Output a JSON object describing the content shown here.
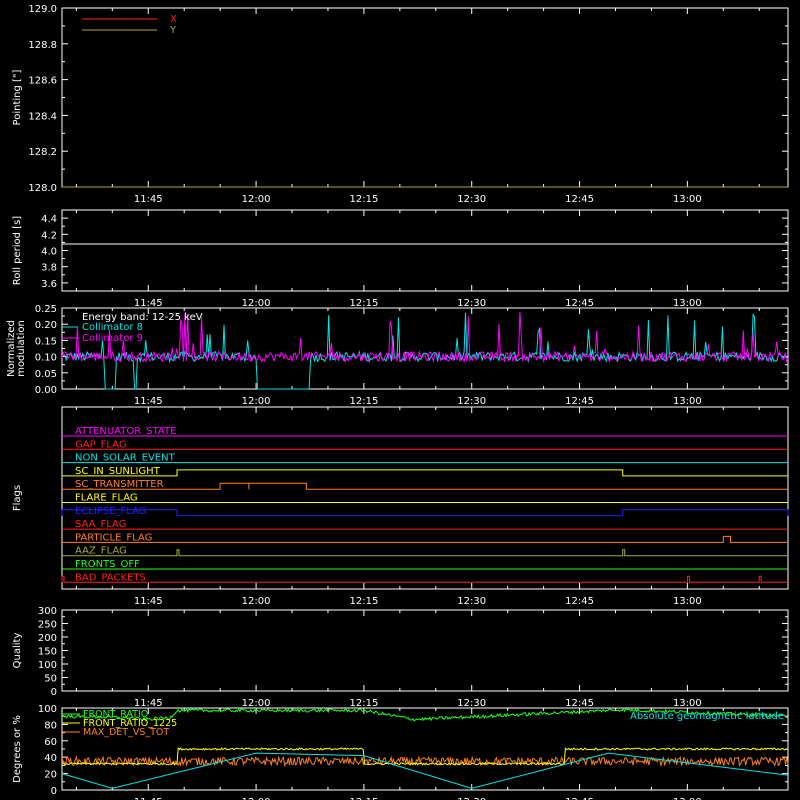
{
  "colors": {
    "background": "#000000",
    "axes": "#ffffff",
    "red": "#ff2020",
    "yellow": "#ffff00",
    "olive": "#a8a838",
    "white": "#ffffff",
    "cyan": "#00e5e5",
    "magenta": "#ff00ff",
    "orange": "#ff8020",
    "blue": "#2020ff",
    "green": "#20ff20"
  },
  "time_axis": {
    "range_minutes": [
      11.55,
      13.23
    ],
    "tick_labels": [
      "11:45",
      "12:00",
      "12:15",
      "12:30",
      "12:45",
      "13:00"
    ]
  },
  "chart_data": [
    {
      "id": "pointing",
      "type": "line",
      "title": "",
      "ylabel": "Pointing [\"]",
      "ylim": [
        128.0,
        129.0
      ],
      "yticks": [
        "128.0",
        "128.2",
        "128.4",
        "128.6",
        "128.8",
        "129.0"
      ],
      "legend": "top-left",
      "series": [
        {
          "name": "X",
          "color": "#ff2020",
          "x": [
            "11:33",
            "13:14"
          ],
          "y": [
            128.0,
            128.0
          ]
        },
        {
          "name": "Y",
          "color": "#a8a838",
          "x": [
            "11:33",
            "13:14"
          ],
          "y": [
            128.0,
            128.0
          ]
        }
      ]
    },
    {
      "id": "roll",
      "type": "line",
      "title": "",
      "ylabel": "Roll period [s]",
      "ylim": [
        3.5,
        4.5
      ],
      "yticks": [
        "3.6",
        "3.8",
        "4.0",
        "4.2",
        "4.4"
      ],
      "series": [
        {
          "color": "#ffffff",
          "x": [
            "11:33",
            "13:14"
          ],
          "y": [
            4.08,
            4.08
          ]
        }
      ]
    },
    {
      "id": "modulation",
      "type": "line",
      "title": "",
      "ylabel": "Normalized modulation",
      "ylim": [
        0,
        0.25
      ],
      "yticks": [
        "0.00",
        "0.05",
        "0.10",
        "0.15",
        "0.20",
        "0.25"
      ],
      "annotation": "Energy band: 12-25 keV",
      "legend": "top-left",
      "series": [
        {
          "name": "Collimator 8",
          "color": "#00e5e5",
          "base": 0.1,
          "dropouts": [
            [
              "11:39",
              "11:40"
            ],
            [
              "11:43",
              "11:43"
            ],
            [
              "12:00",
              "12:07"
            ]
          ]
        },
        {
          "name": "Collimator 9",
          "color": "#ff00ff",
          "base": 0.1
        }
      ]
    },
    {
      "id": "flags",
      "type": "line",
      "title": "",
      "ylabel": "Flags",
      "flags": [
        {
          "name": "ATTENUATOR_STATE",
          "color": "#ff00ff",
          "segments": []
        },
        {
          "name": "GAP_FLAG",
          "color": "#ff2020",
          "segments": []
        },
        {
          "name": "NON_SOLAR_EVENT",
          "color": "#00e5e5",
          "segments": []
        },
        {
          "name": "SC_IN_SUNLIGHT",
          "color": "#ffff00",
          "segments": [
            [
              "11:49",
              "12:51"
            ]
          ]
        },
        {
          "name": "SC_TRANSMITTER",
          "color": "#ff8020",
          "segments": [
            [
              "11:55",
              "11:59"
            ],
            [
              "11:59",
              "12:07"
            ]
          ]
        },
        {
          "name": "FLARE_FLAG",
          "color": "#ffff00",
          "segments": []
        },
        {
          "name": "ECLIPSE_FLAG",
          "color": "#2020ff",
          "segments": [
            [
              "11:33",
              "11:49"
            ],
            [
              "12:51",
              "13:14"
            ]
          ]
        },
        {
          "name": "SAA_FLAG",
          "color": "#ff2020",
          "segments": []
        },
        {
          "name": "PARTICLE_FLAG",
          "color": "#ff8020",
          "segments": [
            [
              "13:05",
              "13:06"
            ]
          ]
        },
        {
          "name": "AAZ_FLAG",
          "color": "#a8a838",
          "segments": [
            [
              "11:49",
              "11:49"
            ],
            [
              "12:51",
              "12:51"
            ]
          ]
        },
        {
          "name": "FRONTS_OFF",
          "color": "#20ff20",
          "segments": []
        },
        {
          "name": "BAD_PACKETS",
          "color": "#ff2020",
          "segments": [
            [
              "11:33",
              "11:33"
            ],
            [
              "13:00",
              "13:00"
            ],
            [
              "13:10",
              "13:10"
            ]
          ]
        }
      ]
    },
    {
      "id": "quality",
      "type": "line",
      "title": "",
      "ylabel": "Quality",
      "ylim": [
        0,
        300
      ],
      "yticks": [
        "0",
        "50",
        "100",
        "150",
        "200",
        "250",
        "300"
      ],
      "series": []
    },
    {
      "id": "degrees",
      "type": "line",
      "title": "",
      "ylabel": "Degrees or %",
      "ylim": [
        0,
        100
      ],
      "yticks": [
        "0",
        "20",
        "40",
        "60",
        "80",
        "100"
      ],
      "legend": "top-left",
      "annotation_right": "Absolute geomagnetic latitude",
      "series": [
        {
          "name": "FRONT_RATIO",
          "color": "#20ff20",
          "x": [
            "11:33",
            "11:43",
            "11:44",
            "11:48",
            "11:49",
            "12:15",
            "12:22",
            "12:51",
            "13:14"
          ],
          "y": [
            90,
            88,
            86,
            88,
            97,
            97,
            86,
            98,
            90
          ]
        },
        {
          "name": "FRONT_RATIO_1225",
          "color": "#ffff00",
          "x": [
            "11:33",
            "11:49",
            "11:49",
            "12:15",
            "12:15",
            "12:43",
            "12:43",
            "13:14"
          ],
          "y": [
            32,
            32,
            50,
            50,
            32,
            32,
            50,
            50
          ]
        },
        {
          "name": "MAX_DET_VS_TOT",
          "color": "#ff8020",
          "x": [
            "11:33",
            "13:14"
          ],
          "y": [
            35,
            35
          ]
        },
        {
          "name": "Absolute geomagnetic latitude",
          "color": "#00e5e5",
          "x": [
            "11:33",
            "11:40",
            "12:00",
            "12:15",
            "12:30",
            "12:49",
            "13:14"
          ],
          "y": [
            20,
            2,
            45,
            42,
            2,
            45,
            18
          ]
        }
      ]
    }
  ]
}
